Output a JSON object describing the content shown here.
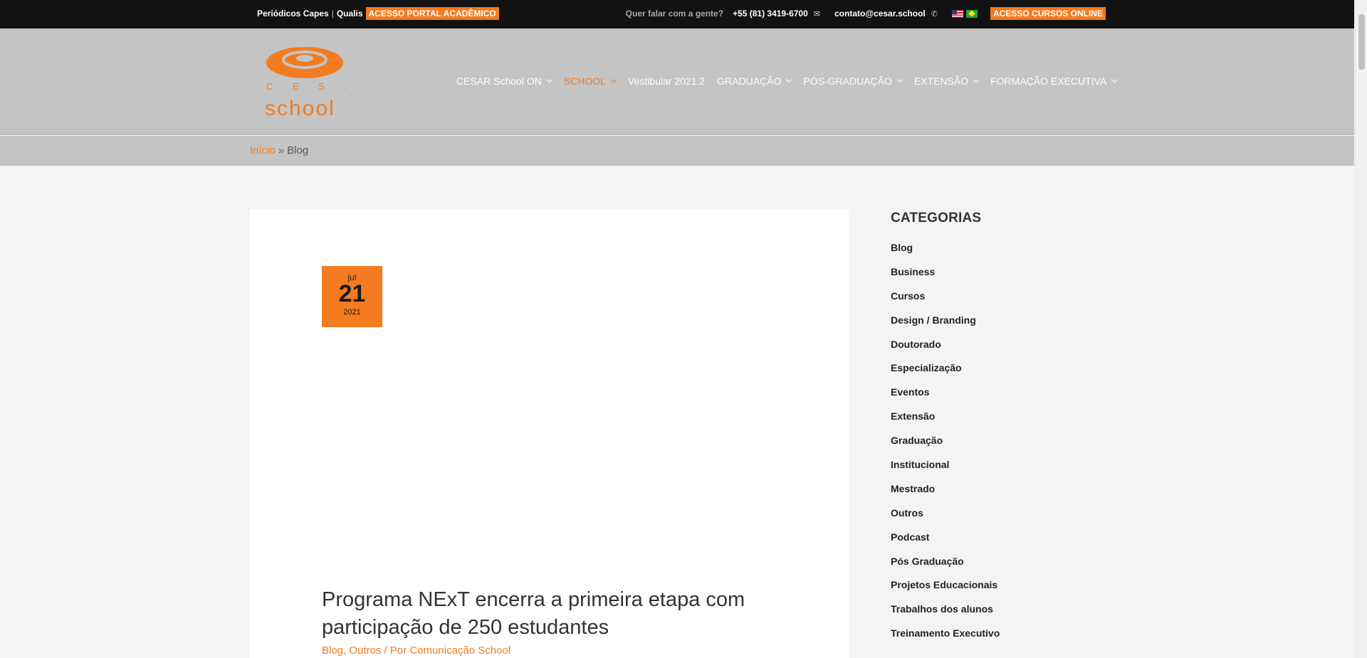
{
  "topbar": {
    "left_link_1": "Periódicos Capes",
    "separator": "|",
    "left_link_2": "Qualis",
    "portal_button": "ACESSO PORTAL ACADÊMICO",
    "contact_prompt": "Quer falar com a gente?",
    "phone": "+55 (81) 3419-6700",
    "email": "contato@cesar.school",
    "courses_button": "ACESSO CURSOS ONLINE"
  },
  "colors": {
    "accent": "#f47b20",
    "topbar_bg": "#121212",
    "header_bg": "#c4c4c4"
  },
  "logo": {
    "letters": "C E S A R",
    "word": "school"
  },
  "nav": {
    "items": [
      {
        "label": "CESAR School ON",
        "has_dropdown": true,
        "active": false
      },
      {
        "label": "SCHOOL",
        "has_dropdown": true,
        "active": true
      },
      {
        "label": "Vestibular 2021.2",
        "has_dropdown": false,
        "active": false
      },
      {
        "label": "GRADUAÇÃO",
        "has_dropdown": true,
        "active": false
      },
      {
        "label": "PÓS-GRADUAÇÃO",
        "has_dropdown": true,
        "active": false
      },
      {
        "label": "EXTENSÃO",
        "has_dropdown": true,
        "active": false
      },
      {
        "label": "FORMAÇÃO EXECUTIVA",
        "has_dropdown": true,
        "active": false
      }
    ]
  },
  "breadcrumb": {
    "home": "Início",
    "separator": "»",
    "current": "Blog"
  },
  "post": {
    "date": {
      "month": "jul",
      "day": "21",
      "year": "2021"
    },
    "title": "Programa NExT encerra a primeira etapa com participação de 250 estudantes",
    "categories": "Blog, Outros",
    "by": " / Por ",
    "author": "Comunicação School"
  },
  "sidebar": {
    "title": "CATEGORIAS",
    "items": [
      "Blog",
      "Business",
      "Cursos",
      "Design / Branding",
      "Doutorado",
      "Especialização",
      "Eventos",
      "Extensão",
      "Graduação",
      "Institucional",
      "Mestrado",
      "Outros",
      "Podcast",
      "Pós Graduação",
      "Projetos Educacionais",
      "Trabalhos dos alunos",
      "Treinamento Executivo"
    ]
  }
}
